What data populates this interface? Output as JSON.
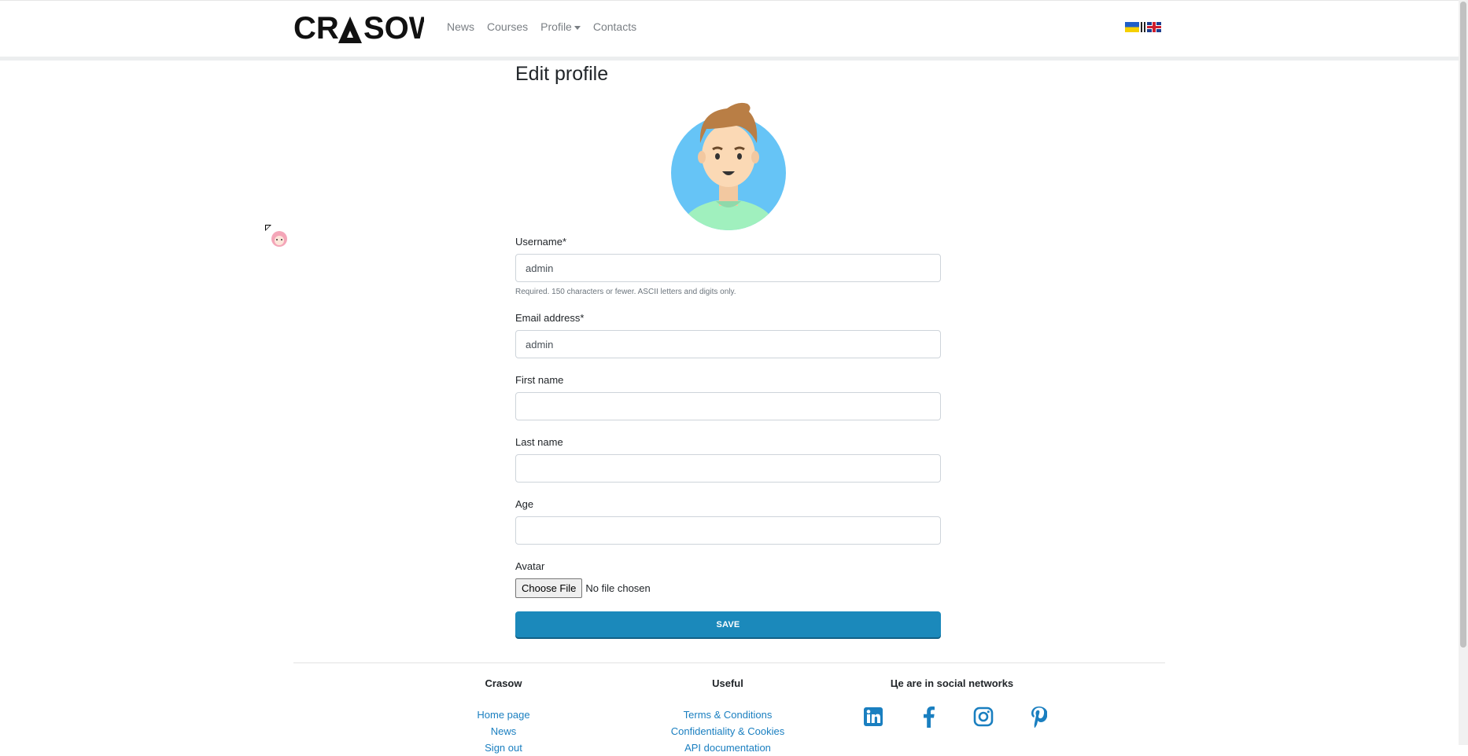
{
  "nav": {
    "logo_text": "CRASOW",
    "links": [
      "News",
      "Courses",
      "Profile",
      "Contacts"
    ],
    "flags": [
      "ua-flag",
      "uk-flag"
    ]
  },
  "page": {
    "title": "Edit profile"
  },
  "form": {
    "username": {
      "label": "Username*",
      "value": "admin",
      "help": "Required. 150 characters or fewer. ASCII letters and digits only."
    },
    "email": {
      "label": "Email address*",
      "value": "admin"
    },
    "first_name": {
      "label": "First name",
      "value": ""
    },
    "last_name": {
      "label": "Last name",
      "value": ""
    },
    "age": {
      "label": "Age",
      "value": ""
    },
    "avatar": {
      "label": "Avatar",
      "button": "Choose File",
      "status": "No file chosen"
    },
    "save": "SAVE"
  },
  "footer": {
    "col1": {
      "title": "Crasow",
      "links": [
        "Home page",
        "News",
        "Sign out"
      ]
    },
    "col2": {
      "title": "Useful",
      "links": [
        "Terms & Conditions",
        "Confidentiality & Cookies",
        "API documentation"
      ]
    },
    "col3": {
      "title": "Це are in social networks",
      "icons": [
        "linkedin-icon",
        "facebook-icon",
        "instagram-icon",
        "pinterest-icon"
      ]
    }
  },
  "colors": {
    "primary": "#1b89bb",
    "link": "#1a7fc0",
    "avatar_bg": "#66c4f6"
  }
}
